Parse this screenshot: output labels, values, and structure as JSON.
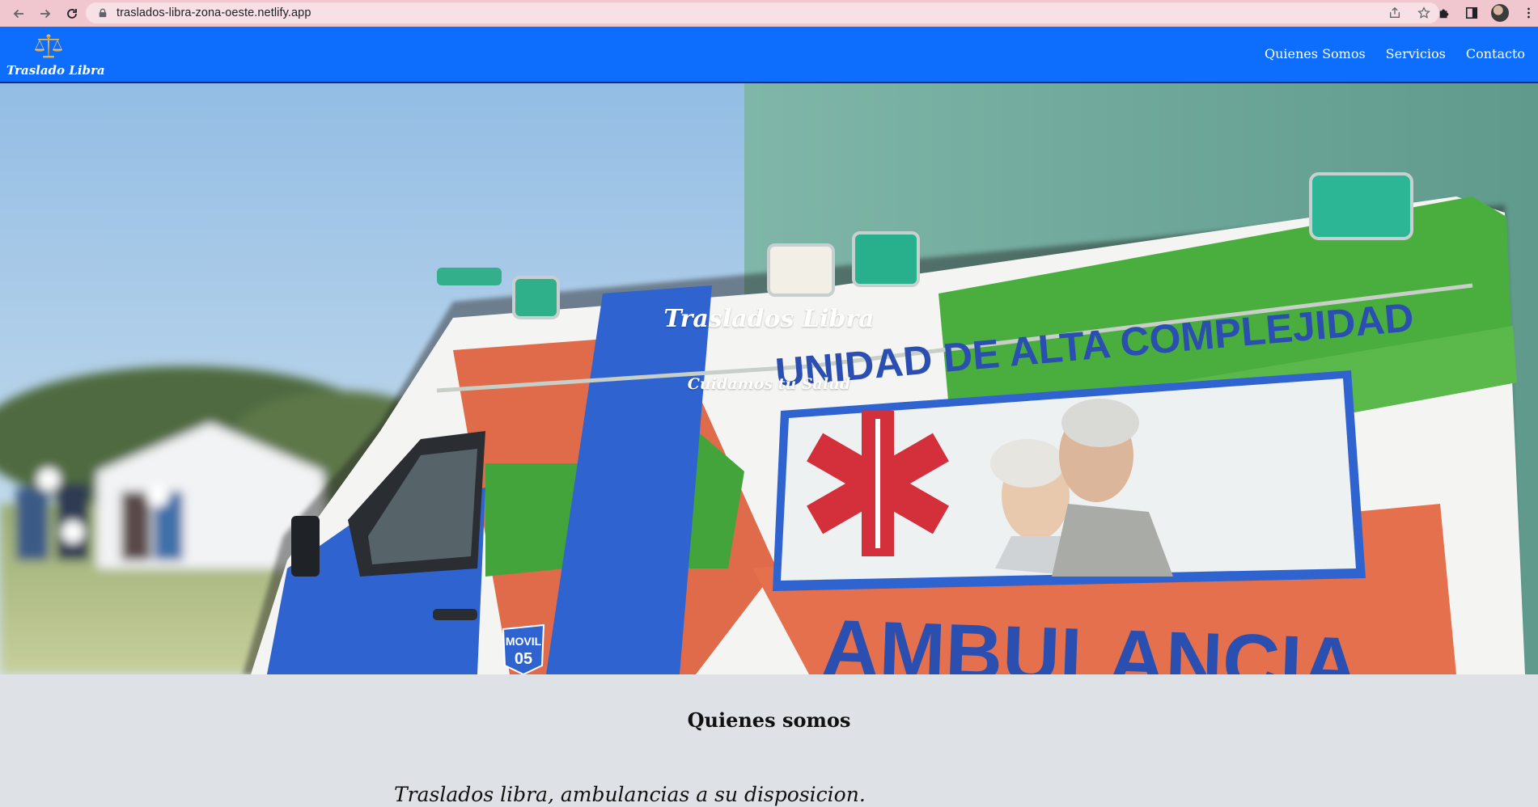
{
  "browser": {
    "url": "traslados-libra-zona-oeste.netlify.app",
    "icons": {
      "back": "back-arrow-icon",
      "forward": "forward-arrow-icon",
      "reload": "reload-icon",
      "lock": "lock-icon",
      "share": "share-icon",
      "bookmark": "star-icon",
      "extensions": "puzzle-icon",
      "sidepanel": "side-panel-icon",
      "menu": "kebab-menu-icon"
    }
  },
  "navbar": {
    "brand": "Traslado Libra",
    "links": [
      "Quienes Somos",
      "Servicios",
      "Contacto"
    ],
    "background_color": "#0d6efd"
  },
  "hero": {
    "title": "Traslados Libra",
    "subtitle": "Cuidamos tu Salud",
    "vehicle_text": {
      "top_banner": "UNIDAD DE ALTA COMPLEJIDAD",
      "side_text": "AMBULANCIA",
      "unit_badge_line1": "MOVIL",
      "unit_badge_line2": "05"
    }
  },
  "about": {
    "heading": "Quienes somos",
    "tagline": "Traslados libra, ambulancias a su disposicion."
  }
}
